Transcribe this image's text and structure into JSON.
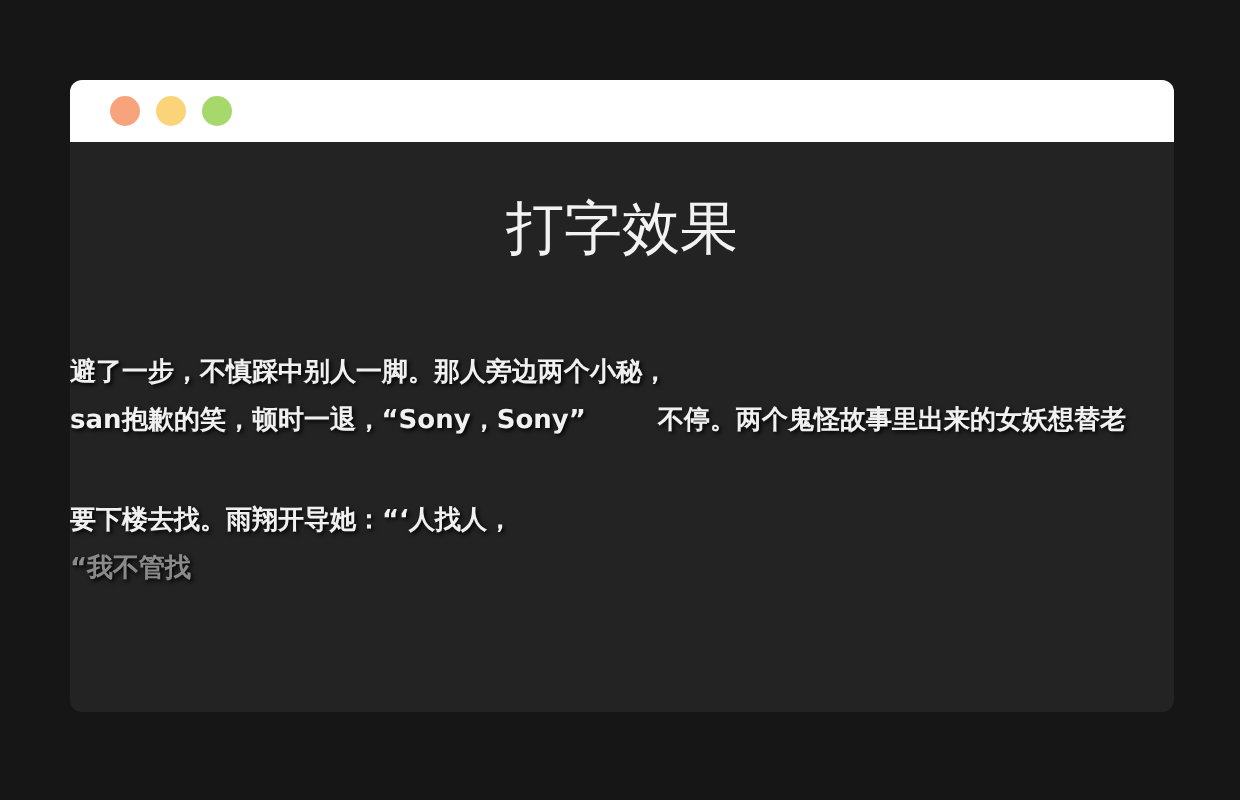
{
  "window": {
    "controls": [
      {
        "color": "#f7a47c"
      },
      {
        "color": "#fbd479"
      },
      {
        "color": "#a7d86b"
      }
    ]
  },
  "title": "打字效果",
  "paragraphs": [
    {
      "lines": [
        {
          "segments": [
            "避了一步，不慎踩中别人一脚。那人旁边两个小秘，"
          ]
        },
        {
          "segments": [
            "san抱歉的笑，顿时一退，“Sony，Sony”",
            "不停。两个鬼怪故事里出来的女妖想替老"
          ]
        }
      ]
    },
    {
      "lines": [
        {
          "segments": [
            "要下楼去找。雨翔开导她：“‘人找人，"
          ]
        },
        {
          "segments": [
            "“我不管找"
          ],
          "kind": "fading"
        }
      ]
    }
  ]
}
